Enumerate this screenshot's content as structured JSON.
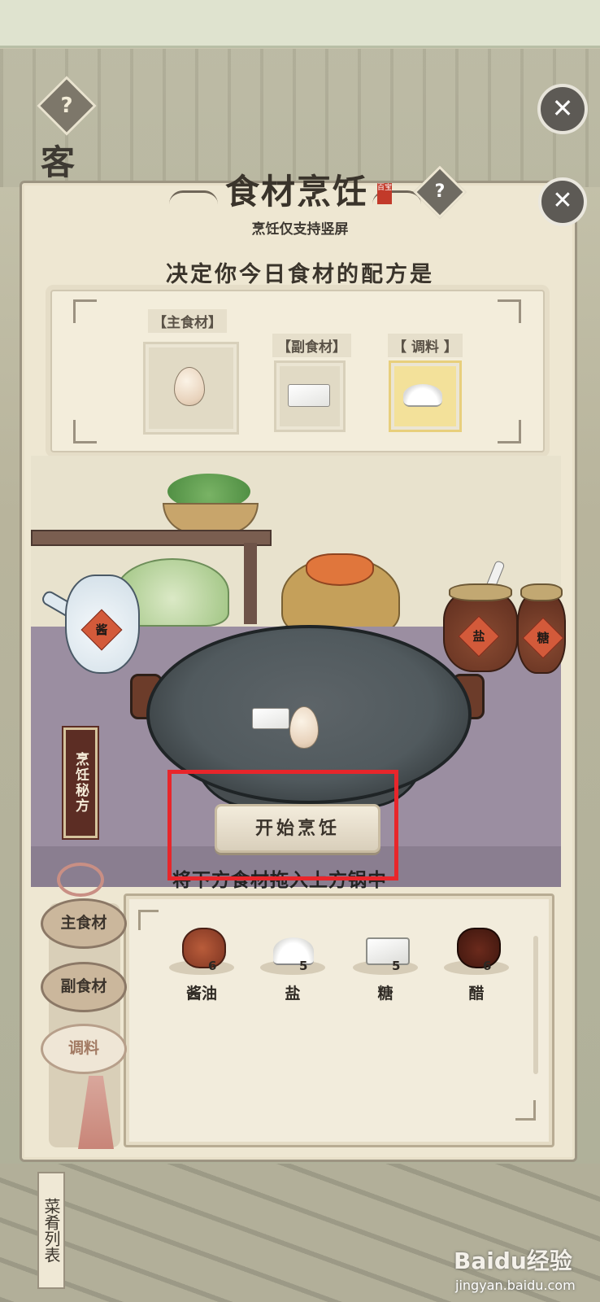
{
  "background": {
    "help_icon": "?",
    "guest_label": "客",
    "close_icon": "✕"
  },
  "panel": {
    "title": "食材烹饪",
    "seal_text": "百宝",
    "help_icon": "?",
    "close_icon": "✕",
    "orientation_note": "烹饪仅支持竖屏",
    "recipe_heading": "决定你今日食材的配方是"
  },
  "recipe_slots": {
    "main_label": "【主食材】",
    "side_label": "【副食材】",
    "seasoning_label": "【 调料 】",
    "main_item_icon": "egg-icon",
    "side_item_icon": "tofu-icon",
    "seasoning_item_icon": "salt-icon",
    "active_slot": "seasoning"
  },
  "kitchen": {
    "sauce_pot_label": "酱",
    "salt_jar_label": "盐",
    "sugar_jar_label": "糖",
    "recipe_book": "烹饪秘方",
    "start_button": "开始烹饪",
    "drag_hint": "将下方食材拖入上方锅中"
  },
  "tabs": [
    {
      "label": "主食材",
      "active": false
    },
    {
      "label": "副食材",
      "active": false
    },
    {
      "label": "调料",
      "active": true
    }
  ],
  "ingredients": [
    {
      "name": "酱油",
      "count": "6",
      "icon": "soy-sauce-icon"
    },
    {
      "name": "盐",
      "count": "5",
      "icon": "salt-icon"
    },
    {
      "name": "糖",
      "count": "5",
      "icon": "sugar-icon"
    },
    {
      "name": "醋",
      "count": "6",
      "icon": "vinegar-icon"
    }
  ],
  "bottom": {
    "dish_list": "菜肴列表",
    "watermark": "Baidu经验",
    "watermark_url": "jingyan.baidu.com"
  },
  "colors": {
    "highlight": "#e8262b",
    "active_slot": "#f3e19a",
    "panel_bg": "#eee7d2"
  }
}
